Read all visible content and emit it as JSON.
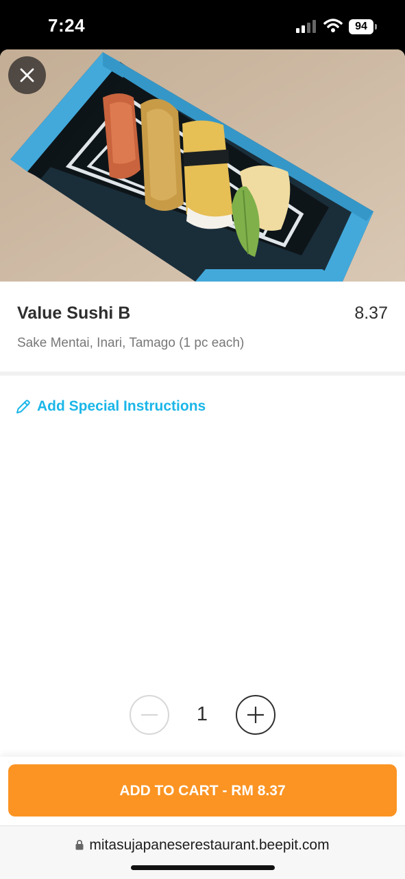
{
  "status_bar": {
    "time": "7:24",
    "battery": "94"
  },
  "product": {
    "name": "Value Sushi B",
    "price": "8.37",
    "description": "Sake Mentai, Inari, Tamago (1 pc each)",
    "image_icon": "sushi-platter-photo"
  },
  "special_instructions": {
    "label": "Add Special Instructions"
  },
  "quantity": {
    "value": "1"
  },
  "cart_button": {
    "label": "ADD TO CART - RM 8.37"
  },
  "browser": {
    "url": "mitasujapaneserestaurant.beepit.com"
  },
  "colors": {
    "accent": "#1bb6e8",
    "cta": "#fb9423"
  }
}
